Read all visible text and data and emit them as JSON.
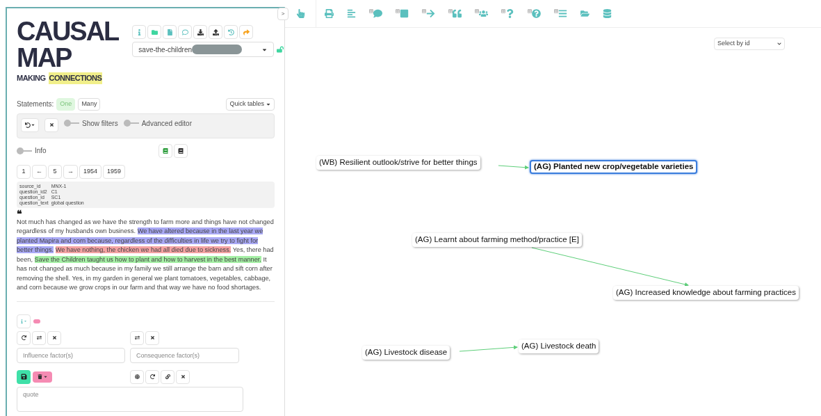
{
  "logo": {
    "line_1": "CAUSAL",
    "line_2": "MAP",
    "tagline_1": "MAKING",
    "tagline_2": "CONNECTIONS"
  },
  "project": {
    "name": "save-the-children",
    "locked": false
  },
  "statements": {
    "label": "Statements:",
    "options": [
      {
        "label": "One",
        "selected": true
      },
      {
        "label": "Many",
        "selected": false
      }
    ],
    "quick_tables": "Quick tables"
  },
  "filters": [
    {
      "label": "Show filters",
      "on": false
    },
    {
      "label": "Advanced editor",
      "on": false
    }
  ],
  "info_toggle": {
    "label": "Info",
    "on": false
  },
  "pager": [
    "1",
    "←",
    "5",
    "→",
    "1954",
    "1959"
  ],
  "metadata": [
    {
      "key": "source_id",
      "value": "MNX-1"
    },
    {
      "key": "question_id2",
      "value": "C1"
    },
    {
      "key": "question_id",
      "value": "SC1"
    },
    {
      "key": "question_text",
      "value": "global question"
    }
  ],
  "quote_mark": "❝",
  "statement_segments": [
    {
      "text": "Not much has changed as we have the strength to farm more and things have not changed regardless of my husbands own business."
    },
    {
      "text": "We have altered because in the last year we planted Mapira and corn because, regardless of the difficulties in life we try to fight for better things.",
      "color": "#a9a9f5"
    },
    {
      "text": "We have nothing, the chicken we had all died due to sickness.",
      "color": "#f5a3a3"
    },
    {
      "text": "Yes, there had been,"
    },
    {
      "text": "Save the Children taught us how to plant and how to harvest in the best manner.",
      "color": "#a6f0a6"
    },
    {
      "text": "It has not changed as much because in my family we still arrange the barn and sift corn after removing the shell. Yes, in my garden in general we plant tomatoes, vegetables, cabbage, and corn because we grow crops in our farm and that way we have no food shortages."
    }
  ],
  "editor": {
    "influence_placeholder": "Influence factor(s)",
    "consequence_placeholder": "Consequence factor(s)",
    "quote_placeholder": "quote"
  },
  "map": {
    "select_placeholder": "Select by id",
    "nodes": [
      {
        "label": "(WB) Resilient outlook/strive for better things",
        "selected": false
      },
      {
        "label": "(AG) Planted new crop/vegetable varieties",
        "selected": true
      },
      {
        "label": "(AG) Learnt about farming method/practice [E]",
        "selected": false
      },
      {
        "label": "(AG) Increased knowledge about farming practices",
        "selected": false
      },
      {
        "label": "(AG) Livestock disease",
        "selected": false
      },
      {
        "label": "(AG) Livestock death",
        "selected": false
      }
    ]
  },
  "collapse_button": ">"
}
